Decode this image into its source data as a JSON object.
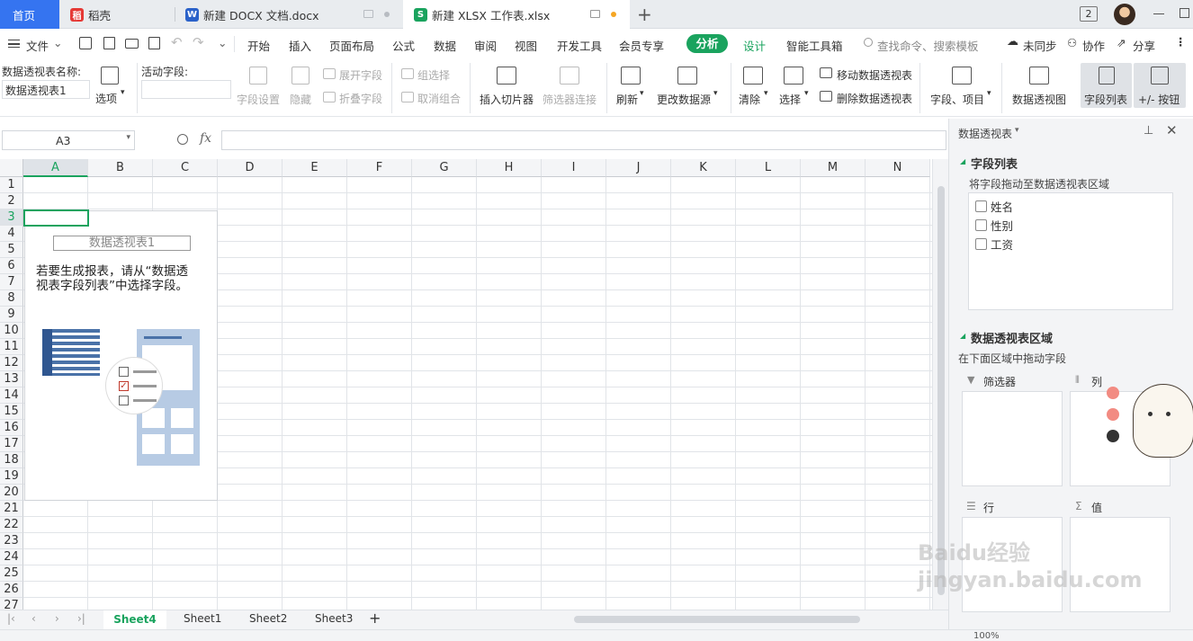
{
  "tabs": [
    {
      "label": "首页",
      "active": true
    },
    {
      "label": "稻壳"
    },
    {
      "label": "新建 DOCX 文档.docx"
    },
    {
      "label": "新建 XLSX 工作表.xlsx"
    }
  ],
  "tab_badge": "2",
  "menu": {
    "file": "文件",
    "items": [
      "开始",
      "插入",
      "页面布局",
      "公式",
      "数据",
      "审阅",
      "视图",
      "开发工具",
      "会员专享"
    ],
    "analyze": "分析",
    "design": "设计",
    "smart_tools": "智能工具箱",
    "search_placeholder": "查找命令、搜索模板",
    "unsynced": "未同步",
    "collab": "协作",
    "share": "分享"
  },
  "ribbon": {
    "pivot_name_label": "数据透视表名称:",
    "pivot_name_value": "数据透视表1",
    "options": "选项",
    "active_field_label": "活动字段:",
    "field_settings": "字段设置",
    "hide": "隐藏",
    "expand_field": "展开字段",
    "collapse_field": "折叠字段",
    "group_selection": "组选择",
    "ungroup": "取消组合",
    "insert_slicer": "插入切片器",
    "filter_connection": "筛选器连接",
    "refresh": "刷新",
    "change_source": "更改数据源",
    "clear": "清除",
    "select": "选择",
    "move_pivot": "移动数据透视表",
    "delete_pivot": "删除数据透视表",
    "fields_items": "字段、项目",
    "pivot_chart": "数据透视图",
    "field_list": "字段列表",
    "plus_minus": "+/- 按钮"
  },
  "formula": {
    "cell_ref": "A3",
    "fx": "fx"
  },
  "grid": {
    "columns": [
      "A",
      "B",
      "C",
      "D",
      "E",
      "F",
      "G",
      "H",
      "I",
      "J",
      "K",
      "L",
      "M",
      "N"
    ],
    "rows": [
      "1",
      "2",
      "3",
      "4",
      "5",
      "6",
      "7",
      "8",
      "9",
      "10",
      "11",
      "12",
      "13",
      "14",
      "15",
      "16",
      "17",
      "18",
      "19",
      "20",
      "21",
      "22",
      "23",
      "24",
      "25",
      "26",
      "27"
    ],
    "placeholder_title": "数据透视表1",
    "placeholder_text_1": "若要生成报表，请从“数据透",
    "placeholder_text_2": "视表字段列表”中选择字段。"
  },
  "panel": {
    "title": "数据透视表",
    "field_list_heading": "字段列表",
    "field_list_hint": "将字段拖动至数据透视表区域",
    "fields": [
      "姓名",
      "性别",
      "工资"
    ],
    "areas_heading": "数据透视表区域",
    "areas_hint": "在下面区域中拖动字段",
    "filter": "筛选器",
    "columns": "列",
    "rows": "行",
    "values": "值"
  },
  "sheets": [
    "Sheet4",
    "Sheet1",
    "Sheet2",
    "Sheet3"
  ],
  "status": {
    "zoom": "100%"
  },
  "watermark": "Baidu经验 jingyan.baidu.com",
  "colors": {
    "accent": "#1aa35e",
    "tab_bg": "#e9ecef",
    "active_tab": "#3574f0"
  }
}
